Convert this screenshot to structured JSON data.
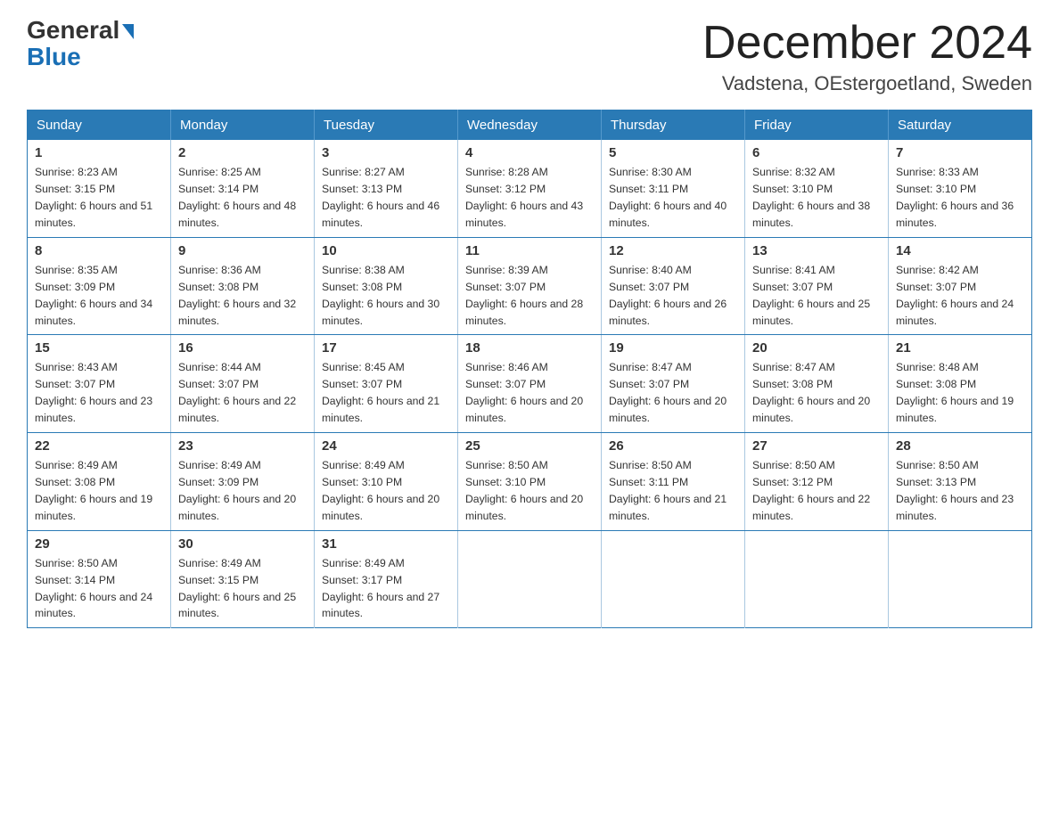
{
  "logo": {
    "general": "General",
    "arrow": "▶",
    "blue": "Blue"
  },
  "title": "December 2024",
  "location": "Vadstena, OEstergoetland, Sweden",
  "days_of_week": [
    "Sunday",
    "Monday",
    "Tuesday",
    "Wednesday",
    "Thursday",
    "Friday",
    "Saturday"
  ],
  "weeks": [
    [
      {
        "day": 1,
        "sunrise": "8:23 AM",
        "sunset": "3:15 PM",
        "daylight": "6 hours and 51 minutes."
      },
      {
        "day": 2,
        "sunrise": "8:25 AM",
        "sunset": "3:14 PM",
        "daylight": "6 hours and 48 minutes."
      },
      {
        "day": 3,
        "sunrise": "8:27 AM",
        "sunset": "3:13 PM",
        "daylight": "6 hours and 46 minutes."
      },
      {
        "day": 4,
        "sunrise": "8:28 AM",
        "sunset": "3:12 PM",
        "daylight": "6 hours and 43 minutes."
      },
      {
        "day": 5,
        "sunrise": "8:30 AM",
        "sunset": "3:11 PM",
        "daylight": "6 hours and 40 minutes."
      },
      {
        "day": 6,
        "sunrise": "8:32 AM",
        "sunset": "3:10 PM",
        "daylight": "6 hours and 38 minutes."
      },
      {
        "day": 7,
        "sunrise": "8:33 AM",
        "sunset": "3:10 PM",
        "daylight": "6 hours and 36 minutes."
      }
    ],
    [
      {
        "day": 8,
        "sunrise": "8:35 AM",
        "sunset": "3:09 PM",
        "daylight": "6 hours and 34 minutes."
      },
      {
        "day": 9,
        "sunrise": "8:36 AM",
        "sunset": "3:08 PM",
        "daylight": "6 hours and 32 minutes."
      },
      {
        "day": 10,
        "sunrise": "8:38 AM",
        "sunset": "3:08 PM",
        "daylight": "6 hours and 30 minutes."
      },
      {
        "day": 11,
        "sunrise": "8:39 AM",
        "sunset": "3:07 PM",
        "daylight": "6 hours and 28 minutes."
      },
      {
        "day": 12,
        "sunrise": "8:40 AM",
        "sunset": "3:07 PM",
        "daylight": "6 hours and 26 minutes."
      },
      {
        "day": 13,
        "sunrise": "8:41 AM",
        "sunset": "3:07 PM",
        "daylight": "6 hours and 25 minutes."
      },
      {
        "day": 14,
        "sunrise": "8:42 AM",
        "sunset": "3:07 PM",
        "daylight": "6 hours and 24 minutes."
      }
    ],
    [
      {
        "day": 15,
        "sunrise": "8:43 AM",
        "sunset": "3:07 PM",
        "daylight": "6 hours and 23 minutes."
      },
      {
        "day": 16,
        "sunrise": "8:44 AM",
        "sunset": "3:07 PM",
        "daylight": "6 hours and 22 minutes."
      },
      {
        "day": 17,
        "sunrise": "8:45 AM",
        "sunset": "3:07 PM",
        "daylight": "6 hours and 21 minutes."
      },
      {
        "day": 18,
        "sunrise": "8:46 AM",
        "sunset": "3:07 PM",
        "daylight": "6 hours and 20 minutes."
      },
      {
        "day": 19,
        "sunrise": "8:47 AM",
        "sunset": "3:07 PM",
        "daylight": "6 hours and 20 minutes."
      },
      {
        "day": 20,
        "sunrise": "8:47 AM",
        "sunset": "3:08 PM",
        "daylight": "6 hours and 20 minutes."
      },
      {
        "day": 21,
        "sunrise": "8:48 AM",
        "sunset": "3:08 PM",
        "daylight": "6 hours and 19 minutes."
      }
    ],
    [
      {
        "day": 22,
        "sunrise": "8:49 AM",
        "sunset": "3:08 PM",
        "daylight": "6 hours and 19 minutes."
      },
      {
        "day": 23,
        "sunrise": "8:49 AM",
        "sunset": "3:09 PM",
        "daylight": "6 hours and 20 minutes."
      },
      {
        "day": 24,
        "sunrise": "8:49 AM",
        "sunset": "3:10 PM",
        "daylight": "6 hours and 20 minutes."
      },
      {
        "day": 25,
        "sunrise": "8:50 AM",
        "sunset": "3:10 PM",
        "daylight": "6 hours and 20 minutes."
      },
      {
        "day": 26,
        "sunrise": "8:50 AM",
        "sunset": "3:11 PM",
        "daylight": "6 hours and 21 minutes."
      },
      {
        "day": 27,
        "sunrise": "8:50 AM",
        "sunset": "3:12 PM",
        "daylight": "6 hours and 22 minutes."
      },
      {
        "day": 28,
        "sunrise": "8:50 AM",
        "sunset": "3:13 PM",
        "daylight": "6 hours and 23 minutes."
      }
    ],
    [
      {
        "day": 29,
        "sunrise": "8:50 AM",
        "sunset": "3:14 PM",
        "daylight": "6 hours and 24 minutes."
      },
      {
        "day": 30,
        "sunrise": "8:49 AM",
        "sunset": "3:15 PM",
        "daylight": "6 hours and 25 minutes."
      },
      {
        "day": 31,
        "sunrise": "8:49 AM",
        "sunset": "3:17 PM",
        "daylight": "6 hours and 27 minutes."
      },
      null,
      null,
      null,
      null
    ]
  ],
  "colors": {
    "header_bg": "#2a7ab5",
    "header_text": "#ffffff",
    "border": "#2a7ab5"
  }
}
